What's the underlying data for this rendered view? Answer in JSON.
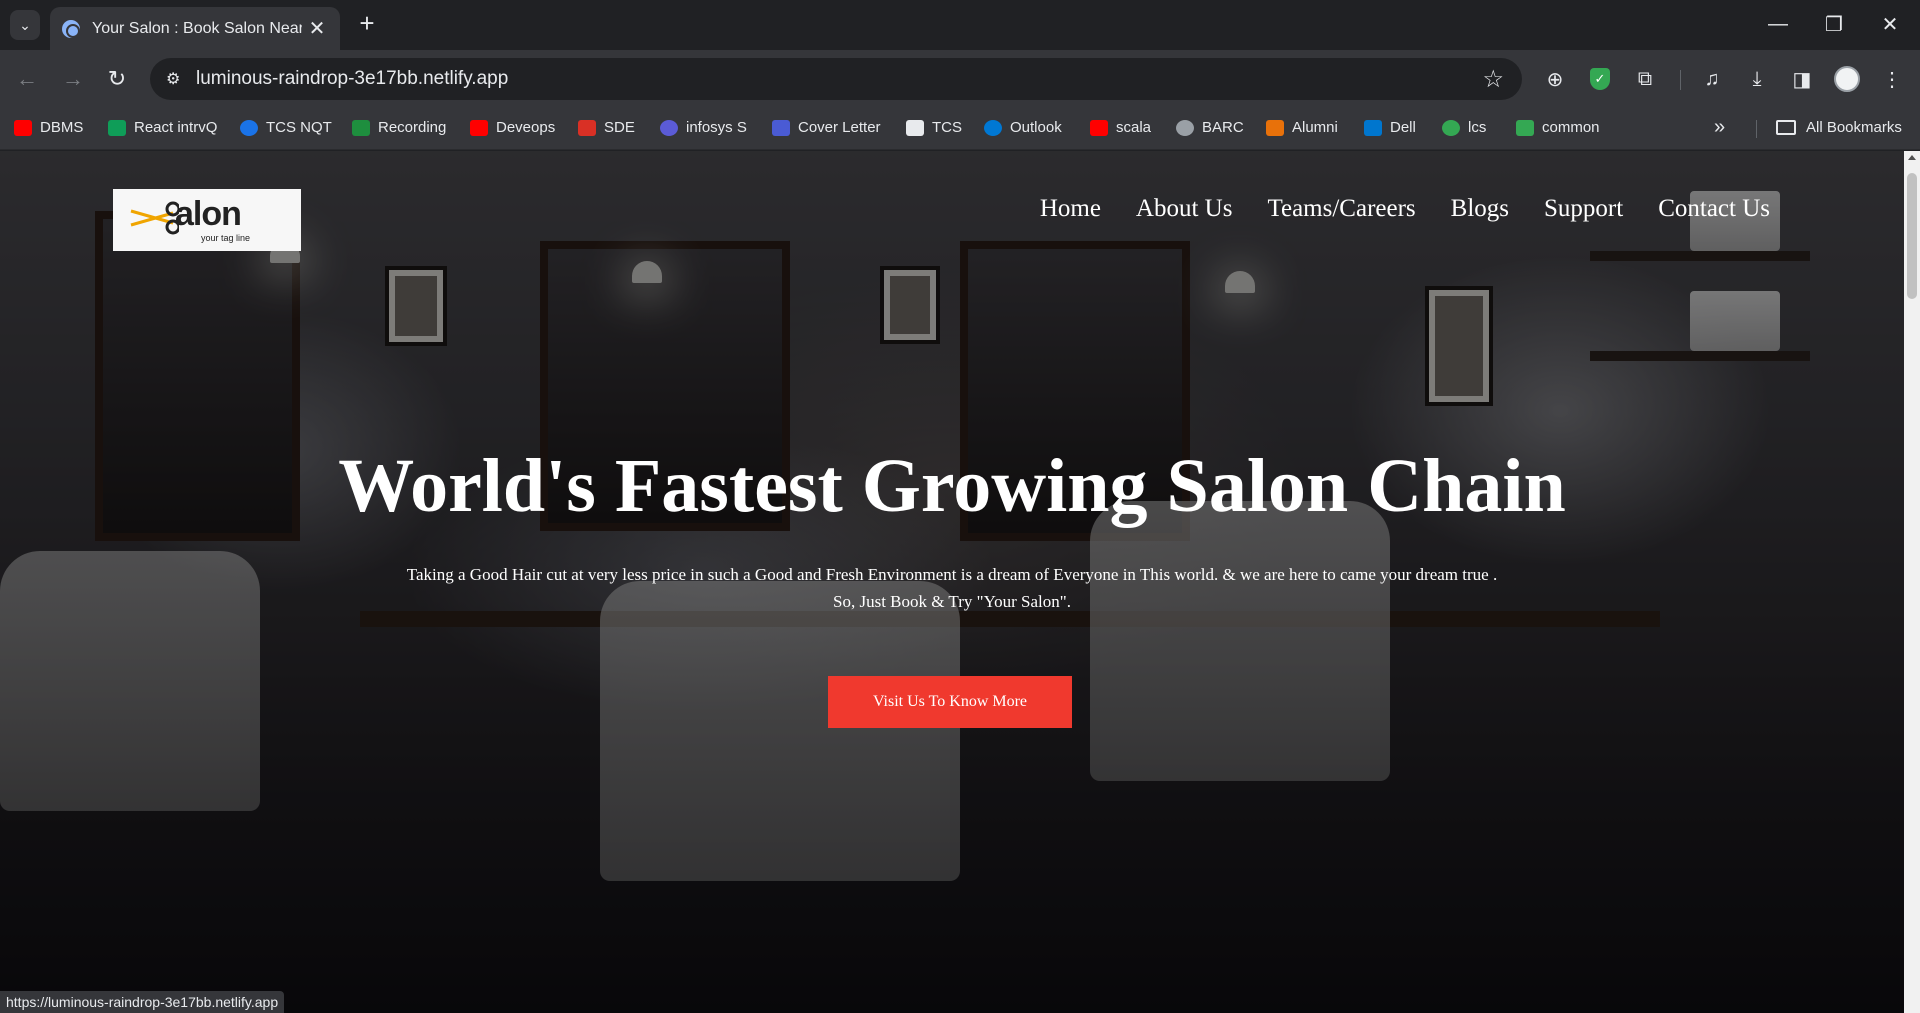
{
  "browser": {
    "tab": {
      "title": "Your Salon : Book Salon Nearby",
      "close": "✕"
    },
    "new_tab": "+",
    "window_controls": {
      "minimize": "—",
      "restore": "❐",
      "close": "✕"
    },
    "url": "luminous-raindrop-3e17bb.netlify.app",
    "status_url": "https://luminous-raindrop-3e17bb.netlify.app",
    "bookmarks": [
      {
        "label": "DBMS",
        "icon": "youtube-icon",
        "color": "#ff0000"
      },
      {
        "label": "React intrvQ",
        "icon": "google-sheets-icon",
        "color": "#0f9d58"
      },
      {
        "label": "TCS NQT",
        "icon": "power-icon",
        "color": "#1a73e8"
      },
      {
        "label": "Recording",
        "icon": "classroom-icon",
        "color": "#1e8e3e"
      },
      {
        "label": "Deveops",
        "icon": "youtube-icon",
        "color": "#ff0000"
      },
      {
        "label": "SDE",
        "icon": "tuf-icon",
        "color": "#d93025"
      },
      {
        "label": "infosys S",
        "icon": "infosys-icon",
        "color": "#5b5bd6"
      },
      {
        "label": "Cover Letter",
        "icon": "docs-icon",
        "color": "#4a5bd4"
      },
      {
        "label": "TCS",
        "icon": "tcs-icon",
        "color": "#e8eaed"
      },
      {
        "label": "Outlook",
        "icon": "outlook-icon",
        "color": "#0078d4"
      },
      {
        "label": "scala",
        "icon": "youtube-icon",
        "color": "#ff0000"
      },
      {
        "label": "BARC",
        "icon": "globe-icon",
        "color": "#9aa0a6"
      },
      {
        "label": "Alumni",
        "icon": "flame-icon",
        "color": "#e8710a"
      },
      {
        "label": "Dell",
        "icon": "dell-icon",
        "color": "#0076ce"
      },
      {
        "label": "lcs",
        "icon": "w-icon",
        "color": "#34a853"
      },
      {
        "label": "common",
        "icon": "link-icon",
        "color": "#34a853"
      }
    ],
    "bookmarks_more": "»",
    "all_bookmarks": "All Bookmarks"
  },
  "site": {
    "logo": {
      "word": "alon",
      "tagline": "your tag line"
    },
    "nav": [
      "Home",
      "About Us",
      "Teams/Careers",
      "Blogs",
      "Support",
      "Contact Us"
    ],
    "hero": {
      "title": "World's Fastest Growing Salon Chain",
      "subtitle_line1": "Taking a Good Hair cut at very less price in such a Good and Fresh Environment is a dream of Everyone in This world. & we are here to came your dream true .",
      "subtitle_line2": "So, Just Book & Try \"Your Salon\".",
      "cta": "Visit Us To Know More"
    }
  },
  "colors": {
    "cta": "#f0392e",
    "logo_accent": "#f0a500"
  }
}
